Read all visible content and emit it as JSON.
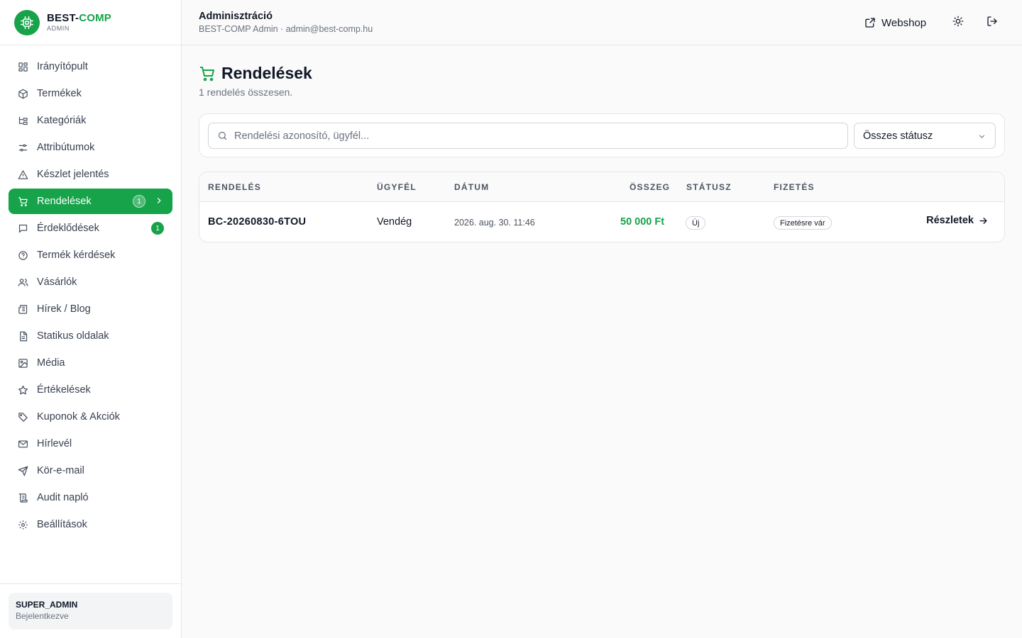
{
  "brand": {
    "name_main": "BEST-",
    "name_accent": "COMP",
    "sub": "ADMIN",
    "accent_color": "#16a34a"
  },
  "sidebar": {
    "items": [
      {
        "label": "Irányítópult",
        "icon": "dashboard-icon"
      },
      {
        "label": "Termékek",
        "icon": "package-icon"
      },
      {
        "label": "Kategóriák",
        "icon": "folder-tree-icon"
      },
      {
        "label": "Attribútumok",
        "icon": "sliders-icon"
      },
      {
        "label": "Készlet jelentés",
        "icon": "warning-triangle-icon"
      },
      {
        "label": "Rendelések",
        "icon": "cart-icon",
        "badge": "1",
        "active": true
      },
      {
        "label": "Érdeklődések",
        "icon": "message-square-icon",
        "badge": "1"
      },
      {
        "label": "Termék kérdések",
        "icon": "help-circle-icon"
      },
      {
        "label": "Vásárlók",
        "icon": "users-icon"
      },
      {
        "label": "Hírek / Blog",
        "icon": "newspaper-icon"
      },
      {
        "label": "Statikus oldalak",
        "icon": "file-text-icon"
      },
      {
        "label": "Média",
        "icon": "image-icon"
      },
      {
        "label": "Értékelések",
        "icon": "star-icon"
      },
      {
        "label": "Kuponok & Akciók",
        "icon": "tag-icon"
      },
      {
        "label": "Hírlevél",
        "icon": "mail-icon"
      },
      {
        "label": "Kör-e-mail",
        "icon": "send-icon"
      },
      {
        "label": "Audit napló",
        "icon": "scroll-icon"
      },
      {
        "label": "Beállítások",
        "icon": "gear-icon"
      }
    ]
  },
  "user": {
    "role": "SUPER_ADMIN",
    "status": "Bejelentkezve"
  },
  "header": {
    "title": "Adminisztráció",
    "subtitle": "BEST-COMP Admin · admin@best-comp.hu",
    "webshop_label": "Webshop"
  },
  "page": {
    "title": "Rendelések",
    "count_text": "1 rendelés összesen."
  },
  "filters": {
    "search_placeholder": "Rendelési azonosító, ügyfél...",
    "status_selected": "Összes státusz"
  },
  "table": {
    "headers": [
      "RENDELÉS",
      "ÜGYFÉL",
      "DÁTUM",
      "ÖSSZEG",
      "STÁTUSZ",
      "FIZETÉS"
    ],
    "rows": [
      {
        "id": "BC-20260830-6TOU",
        "customer": "Vendég",
        "date": "2026. aug. 30. 11:46",
        "amount": "50 000 Ft",
        "status": "Új",
        "payment": "Fizetésre vár",
        "action": "Részletek"
      }
    ]
  }
}
